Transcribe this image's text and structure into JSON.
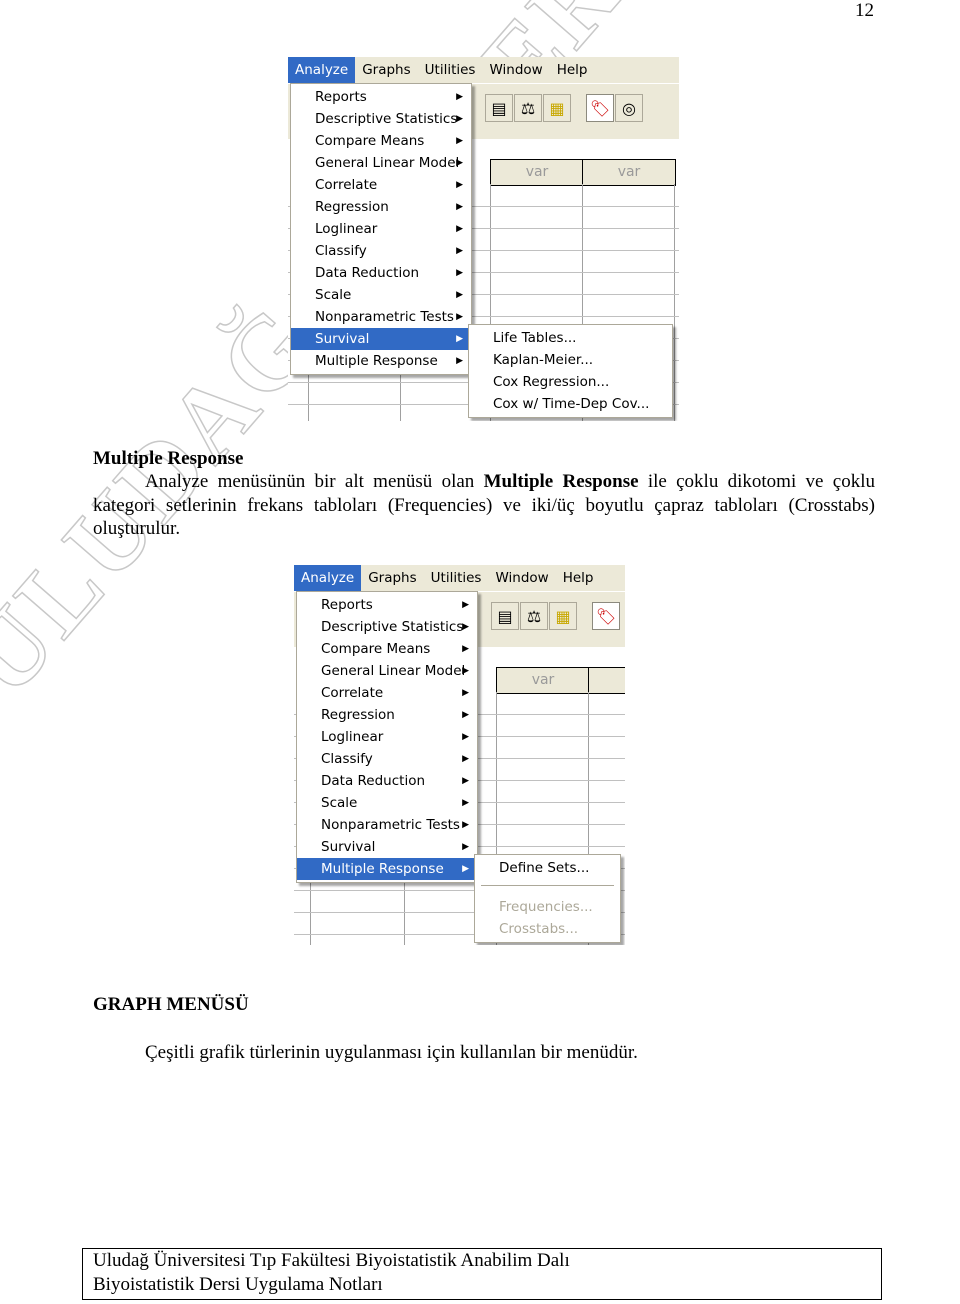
{
  "page_number": "12",
  "watermark": "ULUDAĞ ÜNİVERSİTESİ BİYOİSTATİSTİK A.D.",
  "screenshot1": {
    "menubar": [
      "Analyze",
      "Graphs",
      "Utilities",
      "Window",
      "Help"
    ],
    "active_menu": "Analyze",
    "toolbar_icons": [
      "grid-icon",
      "scale-icon",
      "table-goto-icon",
      "value-labels-icon",
      "sets-icon"
    ],
    "column_headers": [
      "var",
      "var"
    ],
    "analyze_menu": [
      {
        "label": "Reports"
      },
      {
        "label": "Descriptive Statistics"
      },
      {
        "label": "Compare Means"
      },
      {
        "label": "General Linear Model"
      },
      {
        "label": "Correlate"
      },
      {
        "label": "Regression"
      },
      {
        "label": "Loglinear"
      },
      {
        "label": "Classify"
      },
      {
        "label": "Data Reduction"
      },
      {
        "label": "Scale"
      },
      {
        "label": "Nonparametric Tests"
      },
      {
        "label": "Survival",
        "selected": true
      },
      {
        "label": "Multiple Response"
      }
    ],
    "submenu": [
      "Life Tables...",
      "Kaplan-Meier...",
      "Cox Regression...",
      "Cox w/ Time-Dep Cov..."
    ]
  },
  "section1": {
    "heading": "Multiple Response",
    "para_pre": "Analyze menüsünün bir alt menüsü olan ",
    "para_bold": "Multiple Response",
    "para_post": " ile çoklu dikotomi ve çoklu kategori setlerinin frekans tabloları (Frequencies) ve iki/üç boyutlu çapraz tabloları (Crosstabs) oluşturulur."
  },
  "screenshot2": {
    "menubar": [
      "Analyze",
      "Graphs",
      "Utilities",
      "Window",
      "Help"
    ],
    "active_menu": "Analyze",
    "column_headers": [
      "var"
    ],
    "analyze_menu": [
      {
        "label": "Reports"
      },
      {
        "label": "Descriptive Statistics"
      },
      {
        "label": "Compare Means"
      },
      {
        "label": "General Linear Model"
      },
      {
        "label": "Correlate"
      },
      {
        "label": "Regression"
      },
      {
        "label": "Loglinear"
      },
      {
        "label": "Classify"
      },
      {
        "label": "Data Reduction"
      },
      {
        "label": "Scale"
      },
      {
        "label": "Nonparametric Tests"
      },
      {
        "label": "Survival"
      },
      {
        "label": "Multiple Response",
        "selected": true
      }
    ],
    "submenu": [
      {
        "label": "Define Sets...",
        "enabled": true
      },
      {
        "label": "Frequencies...",
        "enabled": false
      },
      {
        "label": "Crosstabs...",
        "enabled": false
      }
    ]
  },
  "section2": {
    "heading": "GRAPH MENÜSÜ",
    "para": "Çeşitli grafik türlerinin uygulanması için kullanılan bir menüdür."
  },
  "footer": {
    "line1": "Uludağ Üniversitesi Tıp Fakültesi Biyoistatistik Anabilim Dalı",
    "line2": "Biyoistatistik Dersi Uygulama Notları"
  }
}
